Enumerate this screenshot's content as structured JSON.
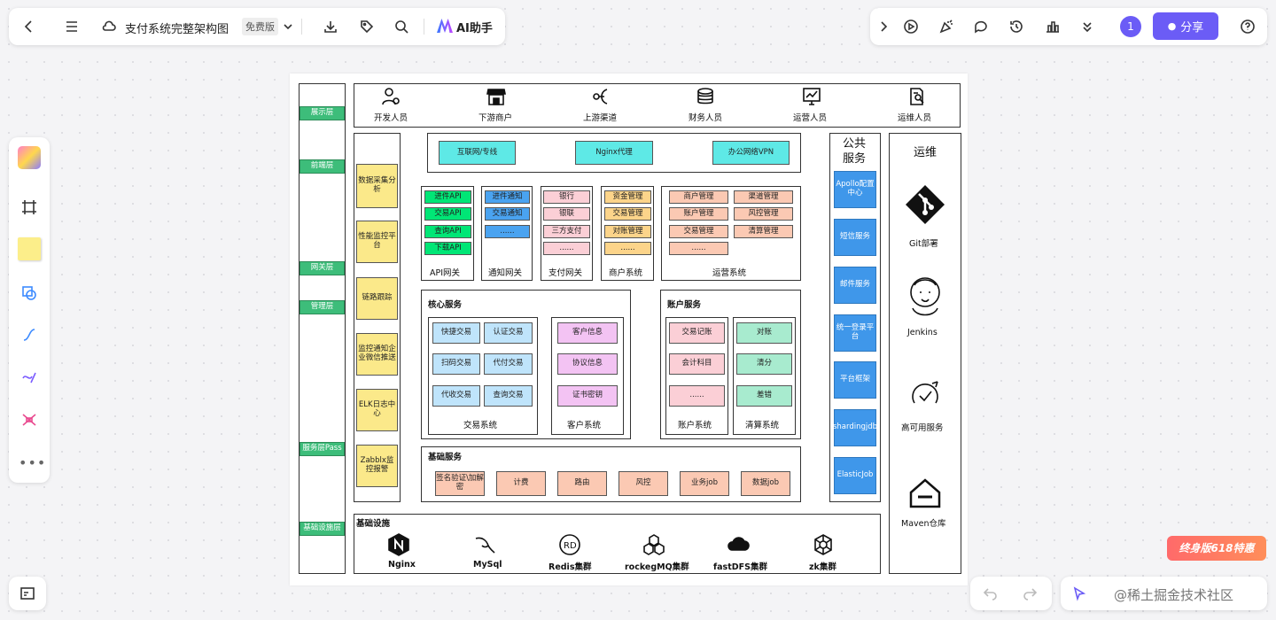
{
  "toolbar": {
    "title": "支付系统完整架构图",
    "plan_badge": "免费版",
    "ai_label": "AI助手",
    "user_count": "1",
    "share_label": "分享"
  },
  "layers": [
    "展示层",
    "前端层",
    "网关层",
    "管理层",
    "服务层Pass",
    "基础设施层"
  ],
  "roles": [
    "开发人员",
    "下游商户",
    "上游渠道",
    "财务人员",
    "运营人员",
    "运维人员"
  ],
  "monitor": [
    "数据采集分析",
    "性能监控平台",
    "链路跟踪",
    "监控通知企业微信推送",
    "ELK日志中心",
    "Zabblx监控报警"
  ],
  "front": [
    "互联网/专线",
    "Nginx代理",
    "办公网络VPN"
  ],
  "gateways": {
    "api": {
      "items": [
        "进件API",
        "交易API",
        "查询API",
        "下载API"
      ],
      "label": "API网关"
    },
    "notify": {
      "items": [
        "进件通知",
        "交易通知",
        "......"
      ],
      "label": "通知网关"
    },
    "pay": {
      "items": [
        "银行",
        "银联",
        "三方支付",
        "......"
      ],
      "label": "支付网关"
    },
    "merchant": {
      "items": [
        "资金管理",
        "交易管理",
        "对账管理",
        "......"
      ],
      "label": "商户系统"
    },
    "ops": {
      "items": [
        "商户管理",
        "渠道管理",
        "账户管理",
        "风控管理",
        "交易管理",
        "清算管理",
        "......"
      ],
      "label": "运营系统"
    }
  },
  "core": {
    "title": "核心服务",
    "trade": [
      "快捷交易",
      "认证交易",
      "扫码交易",
      "代付交易",
      "代收交易",
      "查询交易"
    ],
    "trade_label": "交易系统",
    "customer": [
      "客户信息",
      "协议信息",
      "证书密钥"
    ],
    "customer_label": "客户系统"
  },
  "account": {
    "title": "账户服务",
    "acct": [
      "交易记账",
      "会计科目",
      "......"
    ],
    "acct_label": "账户系统",
    "clear": [
      "对账",
      "清分",
      "差错"
    ],
    "clear_label": "清算系统"
  },
  "base": {
    "title": "基础服务",
    "items": [
      "签名验证\\加解密",
      "计费",
      "路由",
      "风控",
      "业务job",
      "数据job"
    ]
  },
  "infra": {
    "title": "基础设施",
    "items": [
      "Nginx",
      "MySql",
      "Redis集群",
      "rockegMQ集群",
      "fastDFS集群",
      "zk集群"
    ]
  },
  "public": {
    "title": "公共服务",
    "items": [
      "Apollo配置中心",
      "短信服务",
      "邮件服务",
      "统一登录平台",
      "平台框架",
      "shardingjdb",
      "ElasticJob"
    ]
  },
  "ops": {
    "title": "运维",
    "items": [
      "Git部署",
      "Jenkins",
      "高可用服务",
      "Maven仓库"
    ]
  },
  "promo": "终身版618特惠",
  "watermark": "@稀土掘金技术社区"
}
